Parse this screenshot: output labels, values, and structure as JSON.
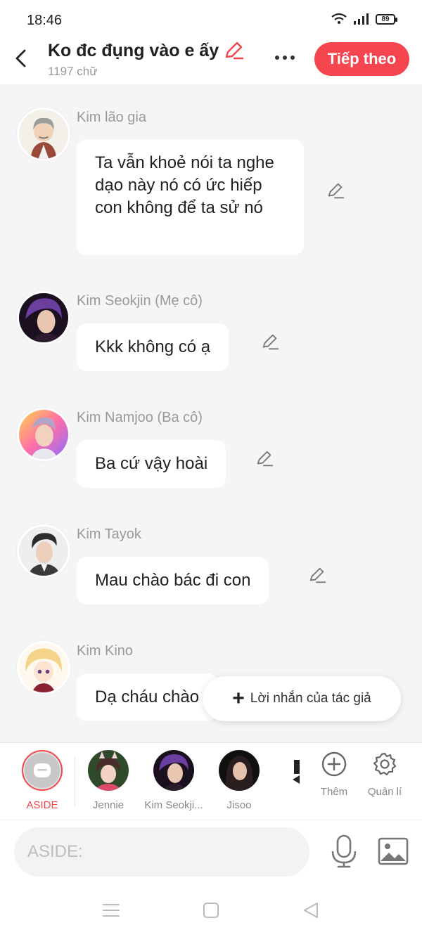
{
  "status": {
    "time": "18:46",
    "battery": "89"
  },
  "header": {
    "title": "Ko đc đụng vào e ấy",
    "word_count": "1197 chữ",
    "next_label": "Tiếp theo"
  },
  "messages": [
    {
      "name": "Kim lão gia",
      "text": "Ta vẫn khoẻ nói ta nghe dạo này nó có ức hiếp con không để ta sử nó"
    },
    {
      "name": "Kim Seokjin (Mẹ cô)",
      "text": "Kkk không có ạ"
    },
    {
      "name": "Kim Namjoo (Ba cô)",
      "text": "Ba cứ vậy hoài"
    },
    {
      "name": "Kim Tayok",
      "text": "Mau chào bác đi con"
    },
    {
      "name": "Kim Kino",
      "text": "Dạ cháu chào"
    }
  ],
  "author_note_label": "Lời nhắn của tác giả",
  "tray": {
    "aside": "ASIDE",
    "characters": [
      "Jennie",
      "Kim Seokji...",
      "Jisoo"
    ],
    "more_label": "Thêm",
    "manage_label": "Quản lí"
  },
  "input": {
    "placeholder": "ASIDE:"
  },
  "colors": {
    "accent": "#f5454f",
    "background": "#f5f5f5"
  },
  "icons": [
    "back-arrow-icon",
    "pencil-icon",
    "more-dots-icon",
    "plus-icon",
    "plus-circle-icon",
    "gear-icon",
    "microphone-icon",
    "image-icon",
    "menu-icon",
    "home-square-icon",
    "back-triangle-icon"
  ]
}
